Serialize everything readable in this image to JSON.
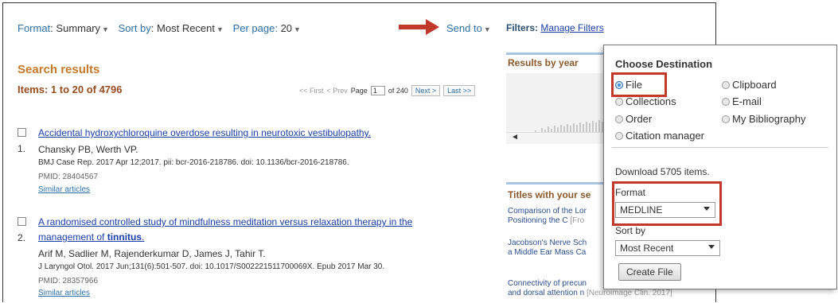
{
  "toolbar": {
    "format_label": "Format",
    "format_value": "Summary",
    "sort_label": "Sort by",
    "sort_value": "Most Recent",
    "perpage_label": "Per page",
    "perpage_value": "20",
    "send_to": "Send to"
  },
  "filters": {
    "label": "Filters:",
    "manage": "Manage Filters"
  },
  "search": {
    "title": "Search results",
    "items_text": "Items: 1 to 20 of 4796"
  },
  "pager": {
    "first": "<< First",
    "prev": "< Prev",
    "page_label": "Page",
    "page_value": "1",
    "of_total": "of 240",
    "next": "Next >",
    "last": "Last >>"
  },
  "results": [
    {
      "num": "1.",
      "title": "Accidental hydroxychloroquine overdose resulting in neurotoxic vestibulopathy.",
      "authors": "Chansky PB, Werth VP.",
      "citation": "BMJ Case Rep. 2017 Apr 12;2017. pii: bcr-2016-218786. doi: 10.1136/bcr-2016-218786.",
      "pmid": "PMID: 28404567",
      "similar": "Similar articles"
    },
    {
      "num": "2.",
      "title_line1": "A randomised controlled study of mindfulness meditation versus relaxation therapy in the",
      "title_line2_pre": "management of ",
      "title_line2_bold": "tinnitus",
      "title_line2_post": ".",
      "authors": "Arif M, Sadlier M, Rajenderkumar D, James J, Tahir T.",
      "citation": "J Laryngol Otol. 2017 Jun;131(6):501-507. doi: 10.1017/S002221511700069X. Epub 2017 Mar 30.",
      "pmid": "PMID: 28357966",
      "similar": "Similar articles"
    }
  ],
  "sidebar": {
    "results_by_year": "Results by year",
    "titles_title": "Titles with your se",
    "titles": [
      {
        "l1": "Comparison of the Lor",
        "l2": "Positioning the C ",
        "src": "[Fro"
      },
      {
        "l1": "Jacobson's Nerve Sch",
        "l2": "a Middle Ear Mass Ca",
        "src": ""
      },
      {
        "l1": "Connectivity of precun",
        "l2": "and dorsal attention n ",
        "src": "[Neuroimage Clin. 2017]"
      }
    ]
  },
  "popup": {
    "heading": "Choose Destination",
    "options": {
      "file": "File",
      "clipboard": "Clipboard",
      "collections": "Collections",
      "email": "E-mail",
      "order": "Order",
      "bibliography": "My Bibliography",
      "citation_manager": "Citation manager"
    },
    "selected": "File",
    "download_text": "Download 5705 items.",
    "format_label": "Format",
    "format_value": "MEDLINE",
    "sortby_label": "Sort by",
    "sortby_value": "Most Recent",
    "create_button": "Create File"
  },
  "colors": {
    "annotation_red": "#c0392b",
    "link_blue": "#1a3ea8",
    "heading_orange": "#c57a2b"
  },
  "icons": [
    "checkbox-icon",
    "dropdown-caret-icon",
    "red-arrow-icon",
    "radio-icon"
  ]
}
